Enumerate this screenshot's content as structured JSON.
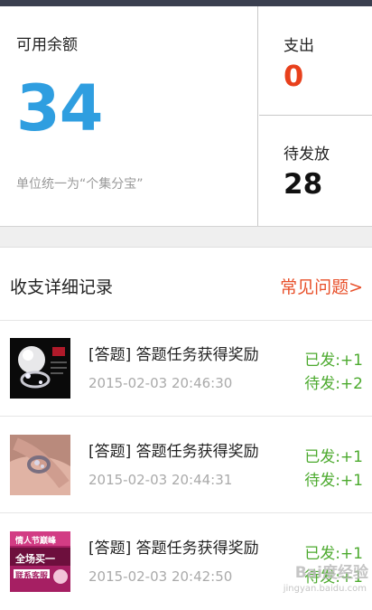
{
  "summary": {
    "balance_label": "可用余额",
    "balance_value": "34",
    "unit_note": "单位统一为“个集分宝”",
    "spend_label": "支出",
    "spend_value": "0",
    "pending_label": "待发放",
    "pending_value": "28"
  },
  "records": {
    "title": "收支详细记录",
    "faq": "常见问题>",
    "items": [
      {
        "title": "[答题] 答题任务获得奖励",
        "time": "2015-02-03 20:46:30",
        "issued": "已发:+1",
        "pending": "待发:+2",
        "image": "pearl-ring-photo"
      },
      {
        "title": "[答题] 答题任务获得奖励",
        "time": "2015-02-03 20:44:31",
        "issued": "已发:+1",
        "pending": "待发:+1",
        "image": "hand-ring-photo"
      },
      {
        "title": "[答题] 答题任务获得奖励",
        "time": "2015-02-03 20:42:50",
        "issued": "已发:+1",
        "pending": "待发:+1",
        "image": "promo-banner",
        "promo_line1": "情人节巅峰",
        "promo_line2": "全场买一",
        "promo_line3": "联系客服"
      }
    ]
  },
  "watermark": {
    "line1": "Bai度经验",
    "line2": "jingyan.baidu.com"
  },
  "colors": {
    "balance": "#2f9ee0",
    "spend": "#e8401c",
    "faq": "#e8502a",
    "status": "#4caa2e"
  }
}
